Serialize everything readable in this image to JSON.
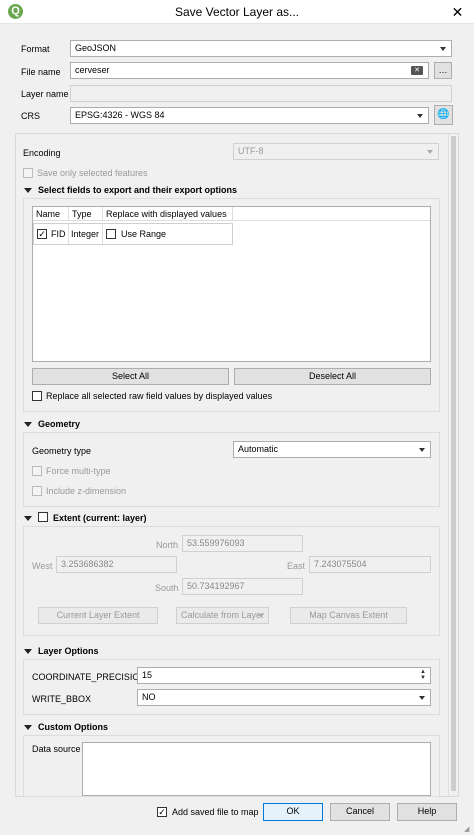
{
  "window": {
    "title": "Save Vector Layer as...",
    "logo": "Q",
    "close_glyph": "✕"
  },
  "form": {
    "format_label": "Format",
    "format_value": "GeoJSON",
    "filename_label": "File name",
    "filename_value": "cerveser",
    "layername_label": "Layer name",
    "layername_value": "",
    "crs_label": "CRS",
    "crs_value": "EPSG:4326 - WGS 84"
  },
  "encoding": {
    "label": "Encoding",
    "value": "UTF-8",
    "save_selected_label": "Save only selected features"
  },
  "fields": {
    "title": "Select fields to export and their export options",
    "columns": [
      "Name",
      "Type",
      "Replace with displayed values"
    ],
    "row": {
      "name": "FID",
      "type": "Integer",
      "replace": "Use Range",
      "checked": true
    },
    "select_all": "Select All",
    "deselect_all": "Deselect All",
    "replace_all_label": "Replace all selected raw field values by displayed values"
  },
  "geometry": {
    "title": "Geometry",
    "type_label": "Geometry type",
    "type_value": "Automatic",
    "force_multi": "Force multi-type",
    "include_z": "Include z-dimension"
  },
  "extent": {
    "title": "Extent (current: layer)",
    "north_label": "North",
    "north_value": "53.559976093",
    "west_label": "West",
    "west_value": "3.253686382",
    "east_label": "East",
    "east_value": "7.243075504",
    "south_label": "South",
    "south_value": "50.734192967",
    "current_layer_btn": "Current Layer Extent",
    "calculate_btn": "Calculate from Layer",
    "map_canvas_btn": "Map Canvas Extent"
  },
  "layer_options": {
    "title": "Layer Options",
    "precision_label": "COORDINATE_PRECISION",
    "precision_value": "15",
    "bbox_label": "WRITE_BBOX",
    "bbox_value": "NO"
  },
  "custom_options": {
    "title": "Custom Options",
    "datasource_label": "Data source"
  },
  "footer": {
    "add_saved_label": "Add saved file to map",
    "ok": "OK",
    "cancel": "Cancel",
    "help": "Help"
  }
}
